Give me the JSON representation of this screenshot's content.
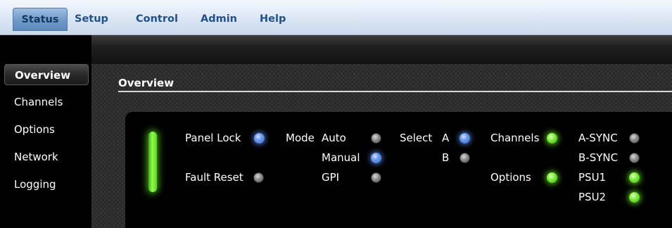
{
  "menu": {
    "tabs": [
      {
        "label": "Status",
        "active": true
      },
      {
        "label": "Setup"
      },
      {
        "label": "Control"
      },
      {
        "label": "Admin"
      },
      {
        "label": "Help"
      }
    ]
  },
  "sidebar": {
    "items": [
      {
        "label": "Overview",
        "active": true
      },
      {
        "label": "Channels"
      },
      {
        "label": "Options"
      },
      {
        "label": "Network"
      },
      {
        "label": "Logging"
      }
    ]
  },
  "main": {
    "section_title": "Overview",
    "panel": {
      "panel_lock": {
        "label": "Panel Lock",
        "led": "blue"
      },
      "fault_reset": {
        "label": "Fault Reset",
        "led": "off"
      },
      "mode": {
        "label": "Mode",
        "options": [
          {
            "label": "Auto",
            "led": "off"
          },
          {
            "label": "Manual",
            "led": "blue"
          },
          {
            "label": "GPI",
            "led": "off"
          }
        ]
      },
      "select": {
        "label": "Select",
        "options": [
          {
            "label": "A",
            "led": "blue"
          },
          {
            "label": "B",
            "led": "off"
          }
        ]
      },
      "channels": {
        "label": "Channels",
        "led": "green"
      },
      "options": {
        "label": "Options",
        "led": "green"
      },
      "sync": [
        {
          "label": "A-SYNC",
          "led": "off"
        },
        {
          "label": "B-SYNC",
          "led": "off"
        }
      ],
      "psu": [
        {
          "label": "PSU1",
          "led": "green"
        },
        {
          "label": "PSU2",
          "led": "green"
        }
      ],
      "status_bar": {
        "state": "green"
      }
    }
  },
  "colors": {
    "led_blue": "#6f9ef2",
    "led_green": "#7ff03a",
    "led_off": "#8a8a8a",
    "tab_text": "#22508c"
  }
}
